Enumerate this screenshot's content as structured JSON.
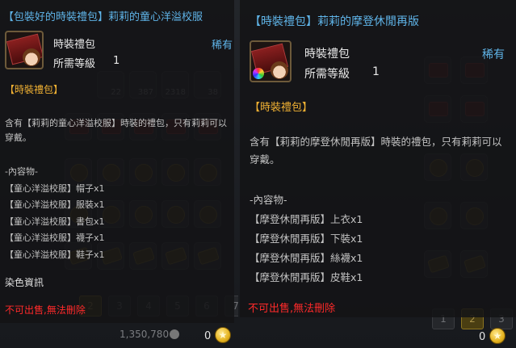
{
  "left_tooltip": {
    "title": "【包裝好的時裝禮包】莉莉的童心洋溢校服",
    "item_name": "時裝禮包",
    "level_label": "所需等級",
    "level_value": "1",
    "rarity": "稀有",
    "category": "【時裝禮包】",
    "description": "含有【莉莉的童心洋溢校服】時裝的禮包，只有莉莉可以穿戴。",
    "contents_header": "-內容物-",
    "contents": [
      "【童心洋溢校服】帽子x1",
      "【童心洋溢校服】服裝x1",
      "【童心洋溢校服】書包x1",
      "【童心洋溢校服】襪子x1",
      "【童心洋溢校服】鞋子x1"
    ],
    "dye_info": "染色資訊",
    "restriction": "不可出售,無法刪除"
  },
  "right_tooltip": {
    "title": "【時裝禮包】莉莉的摩登休閒再版",
    "item_name": "時裝禮包",
    "level_label": "所需等級",
    "level_value": "1",
    "rarity": "稀有",
    "category": "【時裝禮包】",
    "description": "含有【莉莉的摩登休閒再版】時裝的禮包，只有莉莉可以穿戴。",
    "contents_header": "-內容物-",
    "contents": [
      "【摩登休閒再版】上衣x1",
      "【摩登休閒再版】下裝x1",
      "【摩登休閒再版】絲襪x1",
      "【摩登休閒再版】皮鞋x1"
    ],
    "restriction": "不可出售,無法刪除"
  },
  "inventory_left": {
    "slot_counts": [
      "22",
      "387",
      "2318",
      "38"
    ],
    "pages": [
      "2",
      "3",
      "4",
      "5",
      "6",
      "7"
    ],
    "active_page": "2",
    "money": "1,350,780",
    "coin_count": "0"
  },
  "inventory_right": {
    "slot_counts": [
      "22",
      "2"
    ],
    "pages": [
      "1",
      "2",
      "3"
    ],
    "active_page": "2",
    "coin_count": "0"
  },
  "icons": {
    "coin": "star-coin-icon",
    "item": "fashion-gift-box-icon"
  },
  "colors": {
    "title": "#5fb4e8",
    "category": "#f2b233",
    "restriction": "#ff2a2a",
    "tooltip_bg": "#141416"
  }
}
